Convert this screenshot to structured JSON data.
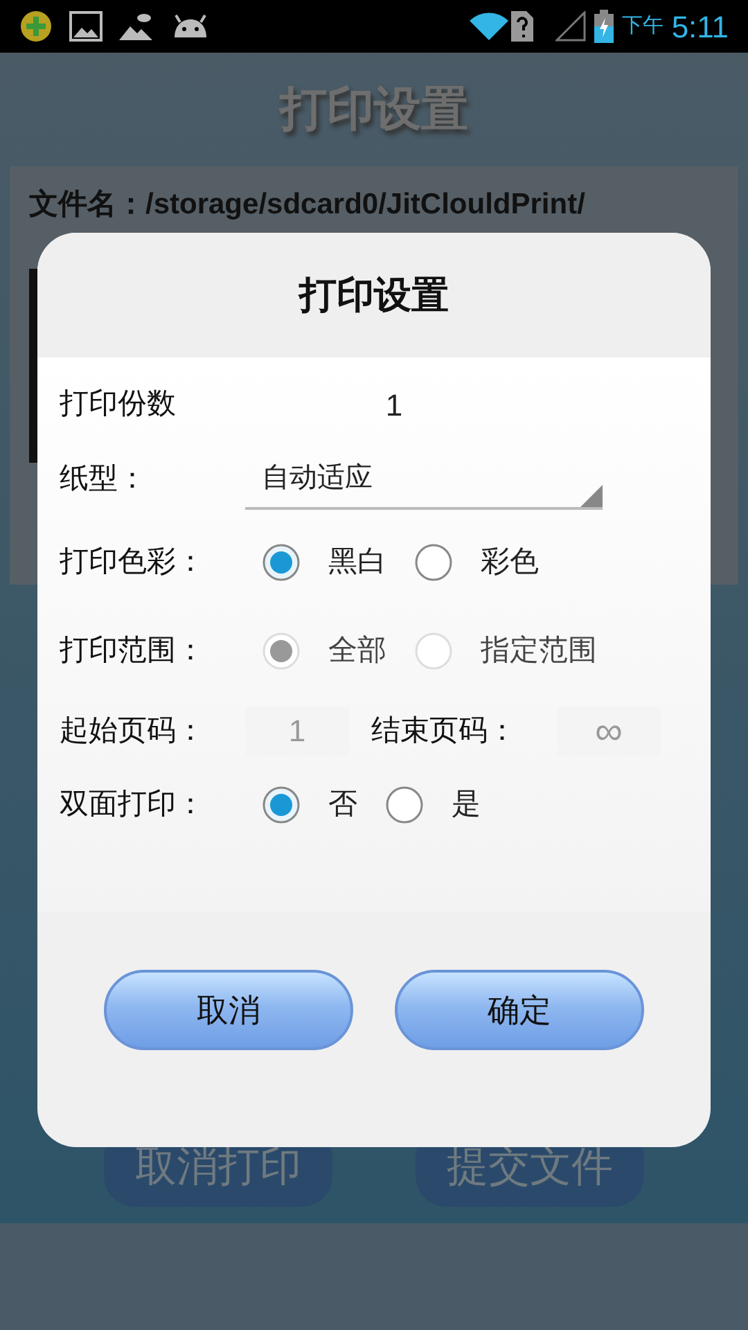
{
  "status_bar": {
    "period": "下午",
    "time": "5:11"
  },
  "screen": {
    "title": "打印设置",
    "file_label": "文件名：/storage/sdcard0/JitClouldPrint/",
    "buttons": [
      "取消打印",
      "提交文件"
    ]
  },
  "dialog": {
    "title": "打印设置",
    "rows": [
      {
        "kind": "number",
        "label": "打印份数",
        "value": "1"
      },
      {
        "kind": "dropdown",
        "label": "纸型：",
        "value": "自动适应"
      },
      {
        "kind": "radio",
        "label": "打印色彩：",
        "disabled": false,
        "options": [
          {
            "label": "黑白",
            "selected": true
          },
          {
            "label": "彩色",
            "selected": false
          }
        ]
      },
      {
        "kind": "radio",
        "label": "打印范围：",
        "disabled": true,
        "options": [
          {
            "label": "全部",
            "selected": true
          },
          {
            "label": "指定范围",
            "selected": false
          }
        ]
      },
      {
        "kind": "page_range",
        "label": "起始页码：",
        "placeholder": "1",
        "end_label": "结束页码：",
        "end_placeholder": "∞"
      },
      {
        "kind": "radio",
        "label": "双面打印：",
        "disabled": false,
        "options": [
          {
            "label": "否",
            "selected": true
          },
          {
            "label": "是",
            "selected": false
          }
        ]
      }
    ],
    "buttons": [
      "取消",
      "确定"
    ]
  }
}
